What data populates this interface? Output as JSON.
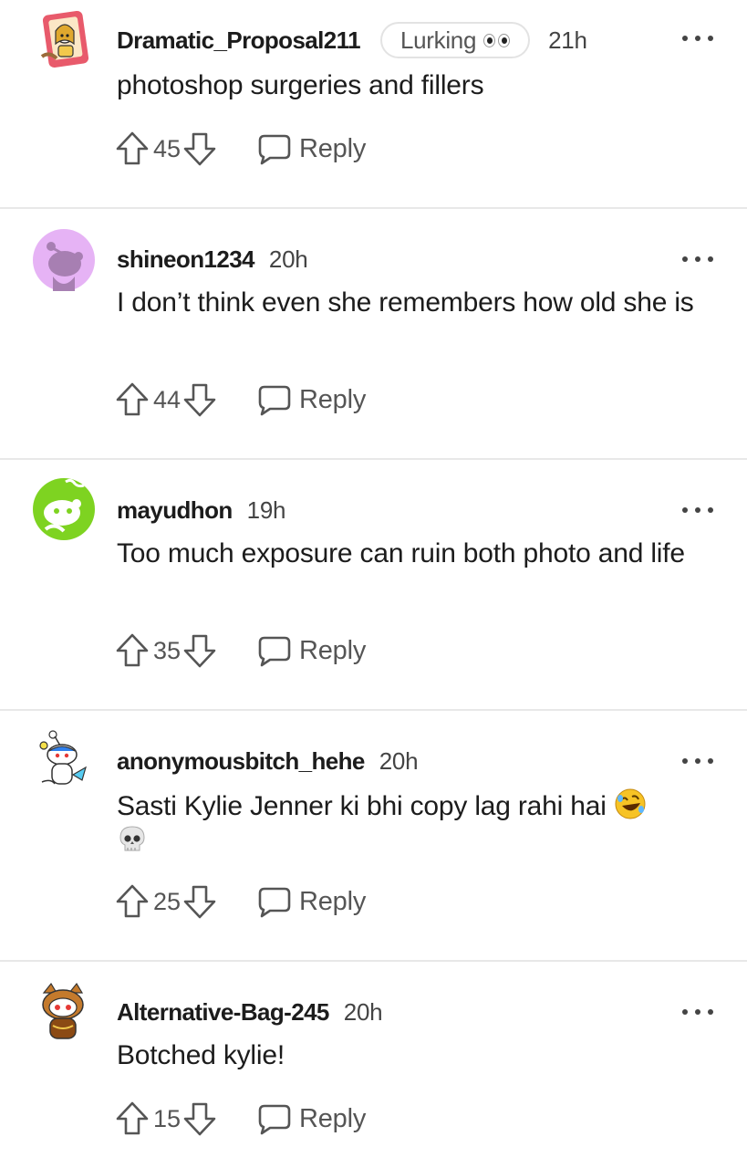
{
  "comments": [
    {
      "username": "Dramatic_Proposal211",
      "flair": "Lurking",
      "time": "21h",
      "body": "photoshop surgeries and fillers",
      "score": "45",
      "reply_label": "Reply",
      "avatar_icon": "snoo-portrait-avatar-icon"
    },
    {
      "username": "shineon1234",
      "time": "20h",
      "body": "I don’t think even she remembers how old she is",
      "score": "44",
      "reply_label": "Reply",
      "avatar_icon": "default-snoo-purple-avatar-icon"
    },
    {
      "username": "mayudhon",
      "time": "19h",
      "body": "Too much exposure can ruin both photo and life",
      "score": "35",
      "reply_label": "Reply",
      "avatar_icon": "default-snoo-green-avatar-icon"
    },
    {
      "username": "anonymousbitch_hehe",
      "time": "20h",
      "body": "Sasti Kylie Jenner ki bhi copy lag rahi hai",
      "score": "25",
      "reply_label": "Reply",
      "avatar_icon": "snoo-outfit-avatar-icon",
      "emojis": [
        "rolling-laughing-emoji",
        "skull-emoji"
      ]
    },
    {
      "username": "Alternative-Bag-245",
      "time": "20h",
      "body": "Botched kylie!",
      "score": "15",
      "reply_label": "Reply",
      "avatar_icon": "snoo-cat-hood-avatar-icon"
    }
  ],
  "colors": {
    "username": "#1c1c1c",
    "meta": "#555555",
    "divider": "#e8e8e8",
    "avatar_purple": "#e6b3f5",
    "avatar_green": "#7ed321"
  }
}
